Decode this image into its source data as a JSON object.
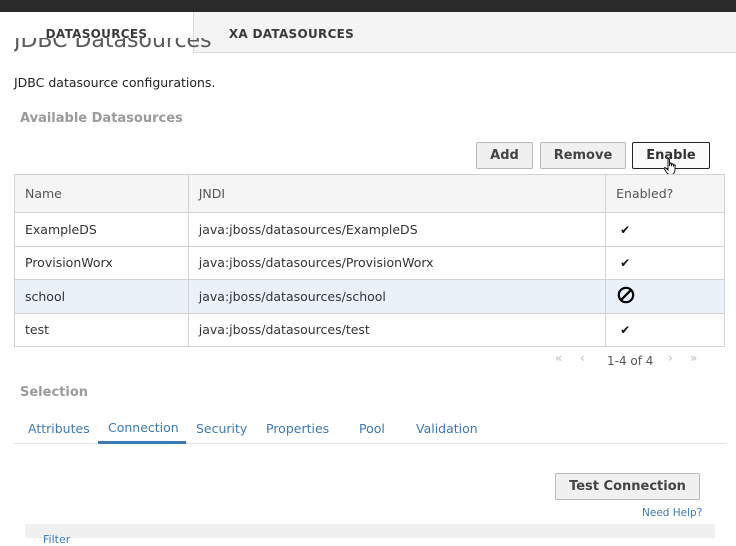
{
  "tabs": [
    {
      "label": "DATASOURCES",
      "active": true
    },
    {
      "label": "XA DATASOURCES",
      "active": false
    }
  ],
  "page": {
    "title": "JDBC Datasources",
    "subtitle": "JDBC datasource configurations."
  },
  "available": {
    "heading": "Available Datasources",
    "buttons": {
      "add": "Add",
      "remove": "Remove",
      "enable": "Enable"
    },
    "columns": [
      "Name",
      "JNDI",
      "Enabled?"
    ],
    "rows": [
      {
        "name": "ExampleDS",
        "jndi": "java:jboss/datasources/ExampleDS",
        "enabled": "✔",
        "selected": false
      },
      {
        "name": "ProvisionWorx",
        "jndi": "java:jboss/datasources/ProvisionWorx",
        "enabled": "✔",
        "selected": false
      },
      {
        "name": "school",
        "jndi": "java:jboss/datasources/school",
        "enabled": "disabled",
        "selected": true
      },
      {
        "name": "test",
        "jndi": "java:jboss/datasources/test",
        "enabled": "✔",
        "selected": false
      }
    ],
    "pager": {
      "first": "«",
      "prev": "‹",
      "text": "1-4 of 4",
      "next": "›",
      "last": "»"
    }
  },
  "selection": {
    "heading": "Selection",
    "tabs": [
      "Attributes",
      "Connection",
      "Security",
      "Properties",
      "Pool",
      "Validation"
    ],
    "active_tab": "Connection",
    "test_button": "Test Connection",
    "help_link": "Need Help?",
    "panel_label": "Filter"
  },
  "colors": {
    "link": "#3c79b1",
    "selected_row": "#eaf1f9",
    "topbar": "#2a2a2a"
  }
}
